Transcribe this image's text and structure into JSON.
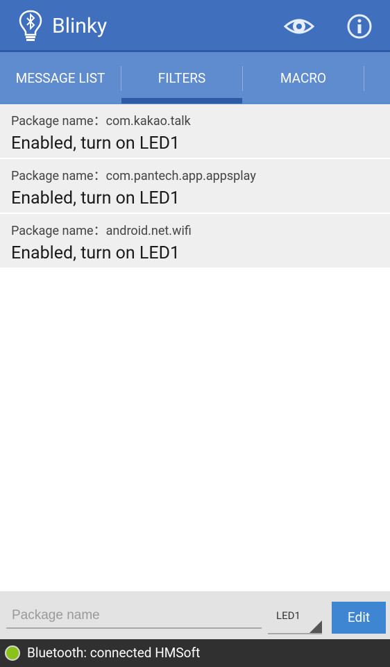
{
  "app": {
    "title": "Blinky"
  },
  "tabs": [
    {
      "label": "MESSAGE LIST"
    },
    {
      "label": "FILTERS",
      "selected": true
    },
    {
      "label": "MACRO"
    }
  ],
  "filters": [
    {
      "package": "Package name：com.kakao.talk",
      "status": "Enabled, turn on LED1"
    },
    {
      "package": "Package name：com.pantech.app.appsplay",
      "status": "Enabled, turn on LED1"
    },
    {
      "package": "Package name：android.net.wifi",
      "status": "Enabled, turn on LED1"
    }
  ],
  "editor": {
    "package_placeholder": "Package name",
    "led_selected": "LED1",
    "edit_label": "Edit"
  },
  "status": {
    "text": "Bluetooth: connected HMSoft",
    "indicator_color": "#8bc21a"
  },
  "icons": {
    "app": "bulb-bluetooth-icon",
    "view": "eye-icon",
    "info": "info-icon"
  },
  "colors": {
    "appbar": "#3f6fbd",
    "tabs": "#5f8bcf",
    "accent": "#2f5ba6",
    "edit_button": "#3f86d2"
  }
}
